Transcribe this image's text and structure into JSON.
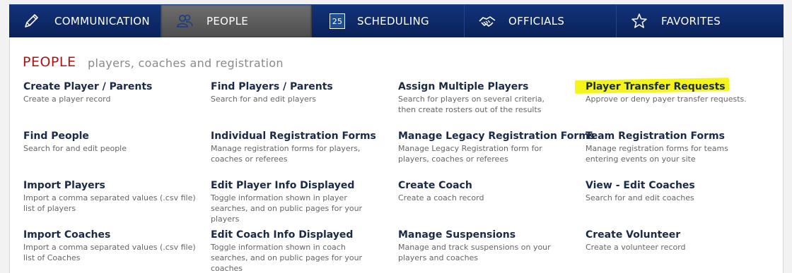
{
  "nav": {
    "items": [
      {
        "label": "COMMUNICATION",
        "icon": "pencil-icon"
      },
      {
        "label": "PEOPLE",
        "icon": "people-icon",
        "active": true
      },
      {
        "label": "SCHEDULING",
        "icon": "calendar-icon",
        "badge": "25"
      },
      {
        "label": "OFFICIALS",
        "icon": "handshake-icon"
      },
      {
        "label": "FAVORITES",
        "icon": "star-icon"
      }
    ]
  },
  "header": {
    "title": "PEOPLE",
    "subtitle": "players, coaches and registration"
  },
  "colors": {
    "nav_bg": "#0f2d6e",
    "active_tab": "#5e5e5e",
    "title_red": "#b01212",
    "highlight": "#f6f51a"
  },
  "links": [
    {
      "title": "Create Player / Parents",
      "desc": "Create a player record"
    },
    {
      "title": "Find Players / Parents",
      "desc": "Search for and edit players"
    },
    {
      "title": "Assign Multiple Players",
      "desc": "Search for players on several criteria, then create rosters out of the results"
    },
    {
      "title": "Player Transfer Requests",
      "desc": "Approve or deny payer transfer requests."
    },
    {
      "title": "Find People",
      "desc": "Search for and edit people"
    },
    {
      "title": "Individual Registration Forms",
      "desc": "Manage registration forms for players, coaches or referees"
    },
    {
      "title": "Manage Legacy Registration Forms",
      "desc": "Manage Legacy Registration form for players, coaches or referees"
    },
    {
      "title": "Team Registration Forms",
      "desc": "Manage registration forms for teams entering events on your site"
    },
    {
      "title": "Import Players",
      "desc": "Import a comma separated values (.csv file) list of players"
    },
    {
      "title": "Edit Player Info Displayed",
      "desc": "Toggle information shown in player searches, and on public pages for your players"
    },
    {
      "title": "Create Coach",
      "desc": "Create a coach record"
    },
    {
      "title": "View - Edit Coaches",
      "desc": "Search for and edit coaches"
    },
    {
      "title": "Import Coaches",
      "desc": "Import a comma separated values (.csv file) list of Coaches"
    },
    {
      "title": "Edit Coach Info Displayed",
      "desc": "Toggle information shown in coach searches, and on public pages for your coaches"
    },
    {
      "title": "Manage Suspensions",
      "desc": "Manage and track suspensions on your players and coaches"
    },
    {
      "title": "Create Volunteer",
      "desc": "Create a volunteer record"
    }
  ]
}
